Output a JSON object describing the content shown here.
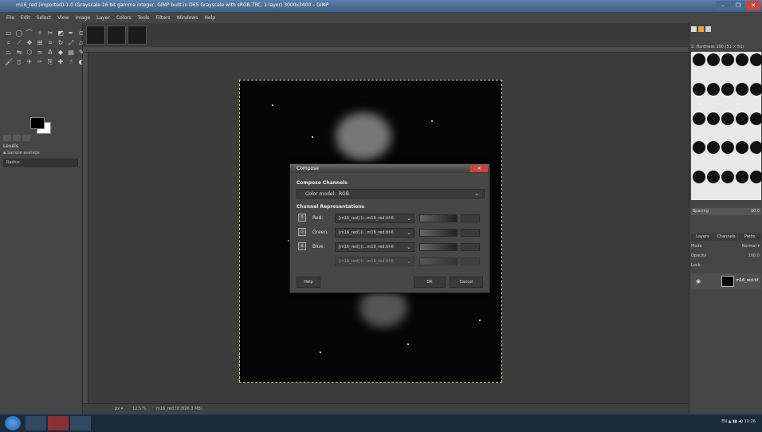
{
  "window": {
    "title": "m16_red (imported)-1.0 (Grayscale 16 bit gamma integer, GIMP built-in D65 Grayscale with sRGB TRC, 1 layer) 3000x3400 – GIMP",
    "minimize": "–",
    "maximize": "❐",
    "close": "✕"
  },
  "menubar": [
    "File",
    "Edit",
    "Select",
    "View",
    "Image",
    "Layer",
    "Colors",
    "Tools",
    "Filters",
    "Windows",
    "Help"
  ],
  "tool_options": {
    "title": "Levels",
    "option": "▪ Sample average",
    "field": "Radius"
  },
  "statusbar": {
    "unit": "px ▾",
    "zoom": "12.5 %",
    "text": "m16_red.tif (826.3 MB)"
  },
  "right_dock": {
    "brush_title": "2. Hardness 100 (51 × 51)",
    "spacing_label": "Spacing",
    "spacing_value": "10.0",
    "tabs": [
      "Layers",
      "Channels",
      "Paths"
    ],
    "mode_label": "Mode",
    "mode_value": "Normal ▾",
    "opacity_label": "Opacity",
    "opacity_value": "100.0",
    "lock_label": "Lock:",
    "layer_name": "m16_red.tif"
  },
  "dialog": {
    "title": "Compose",
    "close": "✕",
    "section_compose": "Compose Channels",
    "color_model_label": "Color model:",
    "color_model_value": "RGB",
    "section_representations": "Channel Representations",
    "channels": [
      {
        "label": "Red:",
        "value": "[m16_red] (i...m16_red.tif-6"
      },
      {
        "label": "Green:",
        "value": "[m16_red] (i...m16_red.tif-6"
      },
      {
        "label": "Blue:",
        "value": "[m16_red] (i...m16_red.tif-6"
      },
      {
        "label": "",
        "value": "[m16_red] (i...m16_red.tif-6"
      }
    ],
    "help": "Help",
    "ok": "OK",
    "cancel": "Cancel"
  },
  "taskbar": {
    "tray": "EN  ▲  ▮▮  ◀)  11:26"
  },
  "colors": {
    "accent": "#c8473c",
    "titlebar": "#3d5f88"
  }
}
